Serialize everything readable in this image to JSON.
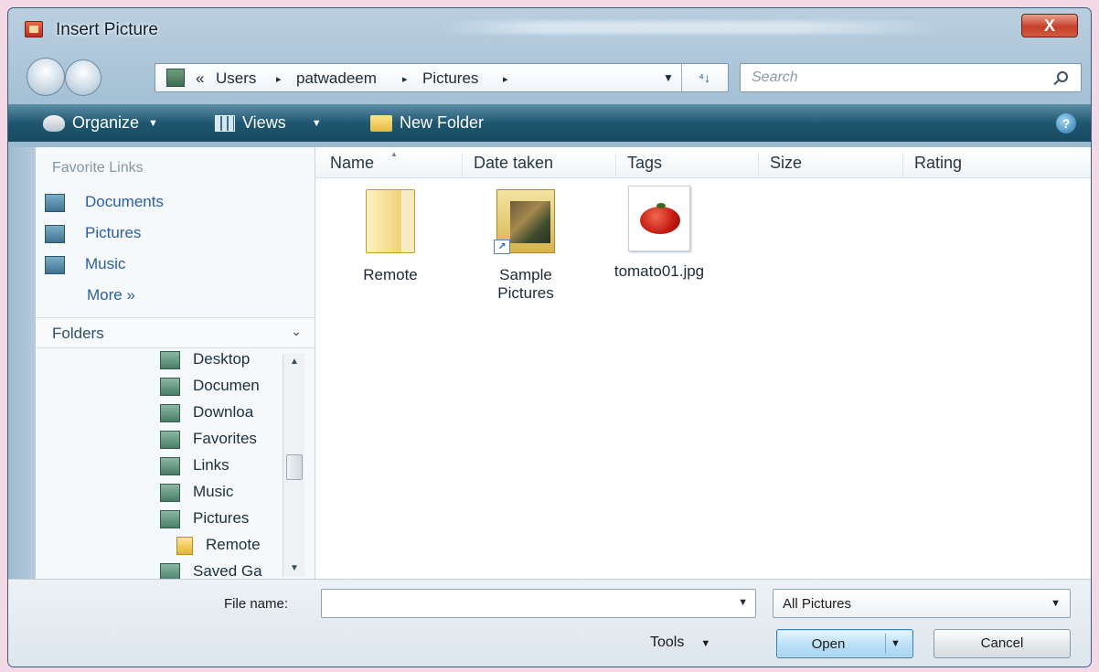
{
  "window": {
    "title": "Insert Picture",
    "close_label": "X"
  },
  "address": {
    "segments": [
      "«",
      "Users",
      "▸",
      "patwadeem",
      "▸",
      "Pictures",
      "▸"
    ],
    "dropdown": "▼",
    "refresh": "⁴↓"
  },
  "search": {
    "placeholder": "Search"
  },
  "toolbar": {
    "organize": "Organize",
    "views": "Views",
    "new_folder": "New Folder",
    "help": "?"
  },
  "favorites": {
    "header": "Favorite Links",
    "items": [
      "Documents",
      "Pictures",
      "Music"
    ],
    "more": "More »"
  },
  "folders": {
    "label": "Folders",
    "chevron": "⌄",
    "tree": [
      "Desktop",
      "Documen",
      "Downloa",
      "Favorites",
      "Links",
      "Music",
      "Pictures",
      "Remote",
      "Saved Ga"
    ]
  },
  "columns": [
    "Name",
    "Date taken",
    "Tags",
    "Size",
    "Rating"
  ],
  "files": [
    {
      "name": "Remote",
      "name2": ""
    },
    {
      "name": "Sample",
      "name2": "Pictures"
    },
    {
      "name": "tomato01.jpg",
      "name2": ""
    }
  ],
  "bottom": {
    "file_name_label": "File name:",
    "file_name_value": "",
    "file_type": "All Pictures",
    "tools": "Tools",
    "open": "Open",
    "cancel": "Cancel"
  }
}
